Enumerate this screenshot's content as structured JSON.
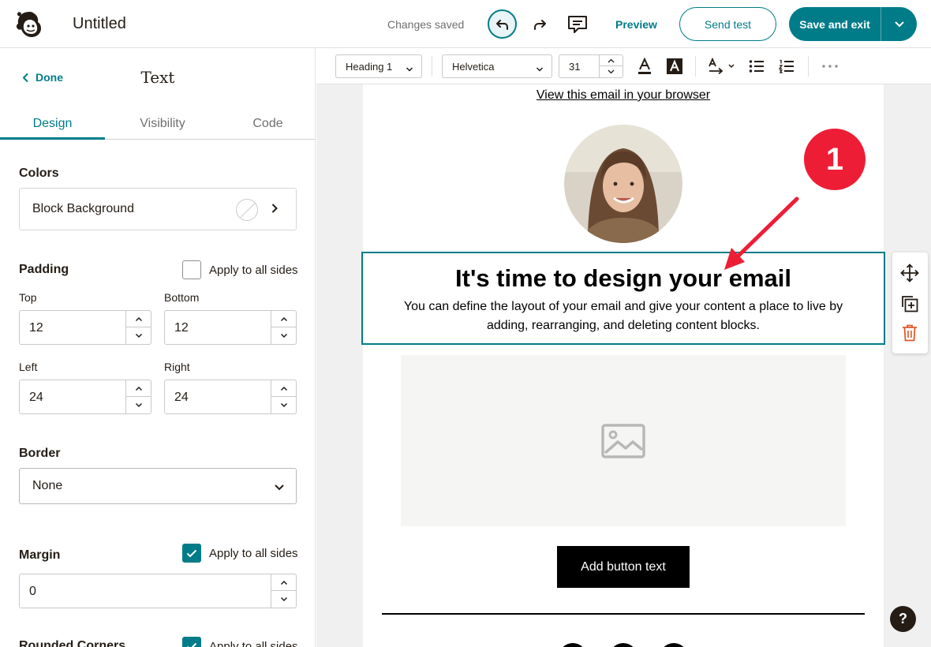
{
  "header": {
    "title": "Untitled",
    "status": "Changes saved",
    "preview_label": "Preview",
    "send_test_label": "Send test",
    "save_exit_label": "Save and exit"
  },
  "sidebar": {
    "done_label": "Done",
    "panel_title": "Text",
    "tabs": [
      {
        "label": "Design",
        "active": true
      },
      {
        "label": "Visibility",
        "active": false
      },
      {
        "label": "Code",
        "active": false
      }
    ],
    "colors": {
      "title": "Colors",
      "block_background_label": "Block Background"
    },
    "padding": {
      "title": "Padding",
      "apply_all_label": "Apply to all sides",
      "apply_all_checked": false,
      "top_label": "Top",
      "top_value": "12",
      "bottom_label": "Bottom",
      "bottom_value": "12",
      "left_label": "Left",
      "left_value": "24",
      "right_label": "Right",
      "right_value": "24"
    },
    "border": {
      "title": "Border",
      "selected": "None"
    },
    "margin": {
      "title": "Margin",
      "apply_all_label": "Apply to all sides",
      "apply_all_checked": true,
      "value": "0"
    },
    "rounded": {
      "title": "Rounded Corners",
      "apply_all_label": "Apply to all sides"
    }
  },
  "toolbar": {
    "style": "Heading 1",
    "font": "Helvetica",
    "size": "31"
  },
  "email": {
    "view_browser_link": "View this email in your browser",
    "heading": "It's time to design your email",
    "body": "You can define the layout of your email and give your content a place to live by adding, rearranging, and deleting content blocks.",
    "button_text": "Add button text"
  },
  "annotation": {
    "step_number": "1"
  },
  "help_label": "?",
  "colors": {
    "accent": "#007c89",
    "badge": "#ee1d36",
    "text": "#241c15"
  },
  "icons": [
    "mailchimp-logo-icon",
    "undo-icon",
    "redo-icon",
    "comment-icon",
    "chevron-down-icon",
    "chevron-left-icon",
    "chevron-right-icon",
    "no-color-icon",
    "text-color-icon",
    "highlight-icon",
    "text-direction-icon",
    "bullet-list-icon",
    "numbered-list-icon",
    "more-icon",
    "image-placeholder-icon",
    "move-icon",
    "duplicate-icon",
    "trash-icon",
    "help-icon"
  ]
}
